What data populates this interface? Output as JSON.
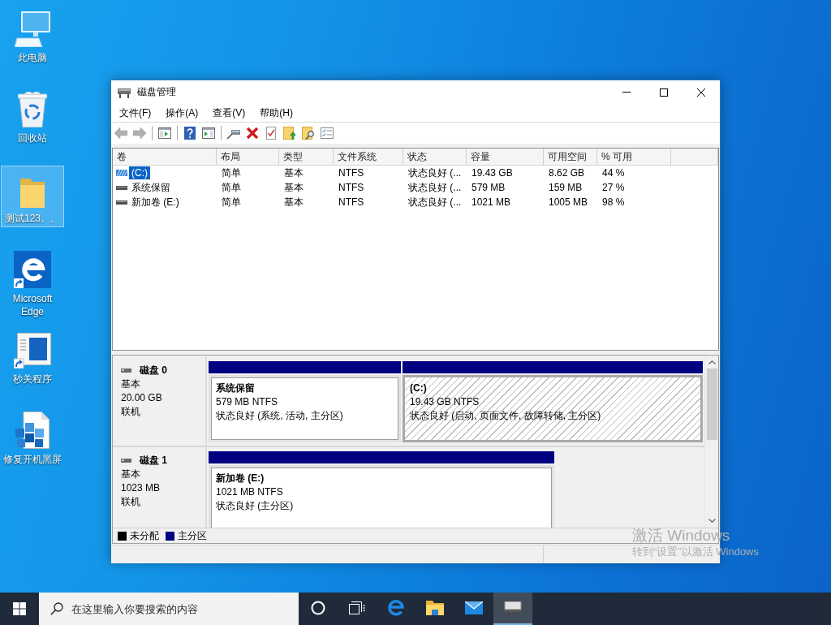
{
  "desktop_icons": [
    {
      "kind": "computer",
      "label": "此电脑",
      "selected": false
    },
    {
      "kind": "recycle_bin",
      "label": "回收站",
      "selected": false
    },
    {
      "kind": "folder",
      "label": "测试123。。",
      "selected": true
    },
    {
      "kind": "edge_shortcut",
      "label": "Microsoft Edge",
      "selected": false
    },
    {
      "kind": "window_shortcut",
      "label": "秒关程序",
      "selected": false
    },
    {
      "kind": "registry_file",
      "label": "修复开机黑屏",
      "selected": false
    }
  ],
  "window": {
    "title": "磁盘管理",
    "menu": [
      "文件(F)",
      "操作(A)",
      "查看(V)",
      "帮助(H)"
    ],
    "toolbar_groups": [
      {
        "buttons": [
          {
            "kind": "back",
            "disabled": true
          },
          {
            "kind": "forward",
            "disabled": true
          }
        ]
      },
      {
        "buttons": [
          {
            "kind": "console_tree",
            "disabled": false
          }
        ]
      },
      {
        "buttons": [
          {
            "kind": "help",
            "disabled": false
          },
          {
            "kind": "action_pane",
            "disabled": false
          }
        ]
      },
      {
        "buttons": [
          {
            "kind": "connect",
            "disabled": false
          },
          {
            "kind": "delete",
            "disabled": false
          },
          {
            "kind": "properties",
            "disabled": false
          },
          {
            "kind": "up_folder",
            "disabled": false
          },
          {
            "kind": "search_folder",
            "disabled": false
          },
          {
            "kind": "checklist",
            "disabled": false
          }
        ]
      }
    ],
    "volume_table": {
      "columns": [
        "卷",
        "布局",
        "类型",
        "文件系统",
        "状态",
        "容量",
        "可用空间",
        "% 可用"
      ],
      "rows": [
        {
          "selected": true,
          "cells": [
            "(C:)",
            "简单",
            "基本",
            "NTFS",
            "状态良好 (...",
            "19.43 GB",
            "8.62 GB",
            "44 %"
          ]
        },
        {
          "selected": false,
          "cells": [
            "系统保留",
            "简单",
            "基本",
            "NTFS",
            "状态良好 (...",
            "579 MB",
            "159 MB",
            "27 %"
          ]
        },
        {
          "selected": false,
          "cells": [
            "新加卷 (E:)",
            "简单",
            "基本",
            "NTFS",
            "状态良好 (...",
            "1021 MB",
            "1005 MB",
            "98 %"
          ]
        }
      ]
    },
    "disks": [
      {
        "name": "磁盘 0",
        "type": "基本",
        "size": "20.00 GB",
        "status": "联机",
        "partitions": [
          {
            "kind": "primary",
            "name": "系统保留",
            "size": "579 MB NTFS",
            "status": "状态良好 (系统, 活动, 主分区)",
            "selected": false
          },
          {
            "kind": "primary",
            "name": "(C:)",
            "size": "19.43 GB NTFS",
            "status": "状态良好 (启动, 页面文件, 故障转储, 主分区)",
            "selected": true
          }
        ]
      },
      {
        "name": "磁盘 1",
        "type": "基本",
        "size": "1023 MB",
        "status": "联机",
        "partitions": [
          {
            "kind": "primary",
            "name": "新加卷  (E:)",
            "size": "1021 MB NTFS",
            "status": "状态良好 (主分区)",
            "selected": false
          }
        ]
      }
    ],
    "legend": [
      {
        "label": "未分配",
        "color": "#000000"
      },
      {
        "label": "主分区",
        "color": "#000080"
      }
    ]
  },
  "activation_notice": {
    "title": "激活 Windows",
    "message": "转到“设置”以激活 Windows"
  },
  "taskbar": {
    "search": {
      "placeholder": "在这里输入你要搜索的内容"
    },
    "apps": [
      {
        "kind": "cortana",
        "selected": false
      },
      {
        "kind": "task_view",
        "selected": false
      },
      {
        "kind": "edge",
        "selected": false
      },
      {
        "kind": "file_explorer",
        "selected": false
      },
      {
        "kind": "mail",
        "selected": false
      },
      {
        "kind": "disk_management",
        "selected": true
      }
    ]
  }
}
